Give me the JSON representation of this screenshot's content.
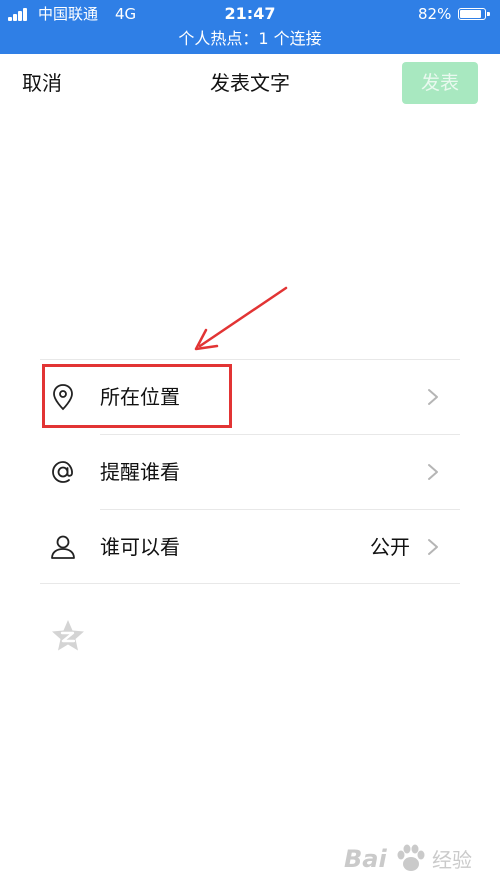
{
  "status_bar": {
    "carrier": "中国联通",
    "network": "4G",
    "time": "21:47",
    "battery": "82%",
    "battery_level": 0.82,
    "hotspot": "个人热点：1 个连接",
    "color": "#2f7fe6"
  },
  "nav": {
    "cancel": "取消",
    "title": "发表文字",
    "publish": "发表",
    "publish_color": "#a8e8c0"
  },
  "rows": [
    {
      "icon": "location-pin-icon",
      "label": "所在位置",
      "value": ""
    },
    {
      "icon": "at-sign-icon",
      "label": "提醒谁看",
      "value": ""
    },
    {
      "icon": "person-icon",
      "label": "谁可以看",
      "value": "公开"
    }
  ],
  "annotation": {
    "color": "#e23434"
  },
  "watermark": {
    "text": "Bai",
    "sub": "经验"
  }
}
